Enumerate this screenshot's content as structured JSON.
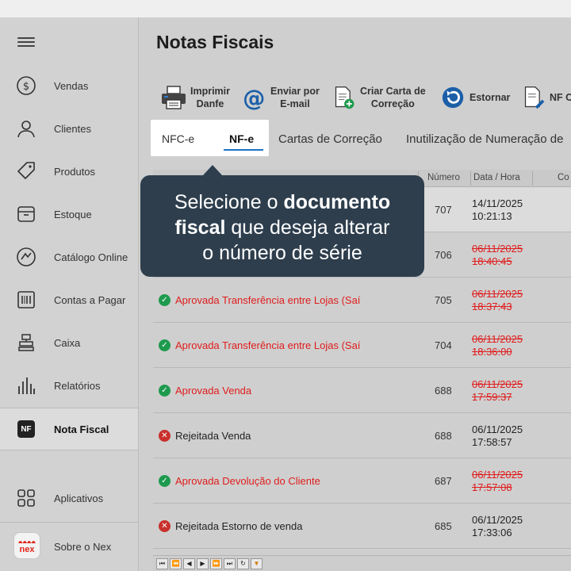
{
  "page": {
    "title": "Notas Fiscais"
  },
  "sidebar": {
    "items": [
      {
        "label": "Vendas",
        "icon": "dollar-circle-icon"
      },
      {
        "label": "Clientes",
        "icon": "user-icon"
      },
      {
        "label": "Produtos",
        "icon": "tag-icon"
      },
      {
        "label": "Estoque",
        "icon": "box-icon"
      },
      {
        "label": "Catálogo Online",
        "icon": "gauge-icon"
      },
      {
        "label": "Contas a Pagar",
        "icon": "barcode-icon"
      },
      {
        "label": "Caixa",
        "icon": "register-icon"
      },
      {
        "label": "Relatórios",
        "icon": "bar-chart-icon"
      },
      {
        "label": "Nota Fiscal",
        "icon": "nf-icon",
        "badge": "NF"
      },
      {
        "label": "Aplicativos",
        "icon": "apps-grid-icon"
      },
      {
        "label": "Sobre o Nex",
        "icon": "nex-logo-icon",
        "logo_text": "nex"
      }
    ]
  },
  "toolbar": {
    "imprimir": {
      "line1": "Imprimir",
      "line2": "Danfe"
    },
    "enviar": {
      "line1": "Enviar por",
      "line2": "E-mail"
    },
    "carta": {
      "line1": "Criar Carta de",
      "line2": "Correção"
    },
    "estornar": {
      "label": "Estornar"
    },
    "nfc": {
      "label": "NF C"
    }
  },
  "tabs": [
    {
      "label": "NFC-e"
    },
    {
      "label": "NF-e"
    },
    {
      "label": "Cartas de Correção"
    },
    {
      "label": "Inutilização de Numeração de"
    }
  ],
  "tooltip": {
    "p1": "Selecione o ",
    "b1": "documento",
    "b2": "fiscal",
    "p2": " que deseja alterar",
    "p3": "o número de série"
  },
  "table": {
    "headers": {
      "numero": "Número",
      "data": "Data / Hora",
      "extra": "Co"
    },
    "rows": [
      {
        "status": "",
        "numero": "707",
        "date": "14/11/2025",
        "time": "10:21:13",
        "state": "none"
      },
      {
        "status": "",
        "numero": "706",
        "date": "06/11/2025",
        "time": "18:40:45",
        "state": "none-strike"
      },
      {
        "status": "Aprovada  Transferência entre Lojas (Saí",
        "numero": "705",
        "date": "06/11/2025",
        "time": "18:37:43",
        "state": "ok"
      },
      {
        "status": "Aprovada  Transferência entre Lojas (Saí",
        "numero": "704",
        "date": "06/11/2025",
        "time": "18:36:00",
        "state": "ok"
      },
      {
        "status": "Aprovada  Venda",
        "numero": "688",
        "date": "06/11/2025",
        "time": "17:59:37",
        "state": "ok"
      },
      {
        "status": "Rejeitada  Venda",
        "numero": "688",
        "date": "06/11/2025",
        "time": "17:58:57",
        "state": "err"
      },
      {
        "status": "Aprovada  Devolução do Cliente",
        "numero": "687",
        "date": "06/11/2025",
        "time": "17:57:08",
        "state": "ok"
      },
      {
        "status": "Rejeitada  Estorno de venda",
        "numero": "685",
        "date": "06/11/2025",
        "time": "17:33:06",
        "state": "err"
      }
    ]
  },
  "colors": {
    "approved_red": "#e01c1c",
    "ok_green": "#1e9a4e",
    "error_red": "#c9302c",
    "tooltip_bg": "#2e3e4d",
    "tab_underline": "#1a73c8"
  }
}
